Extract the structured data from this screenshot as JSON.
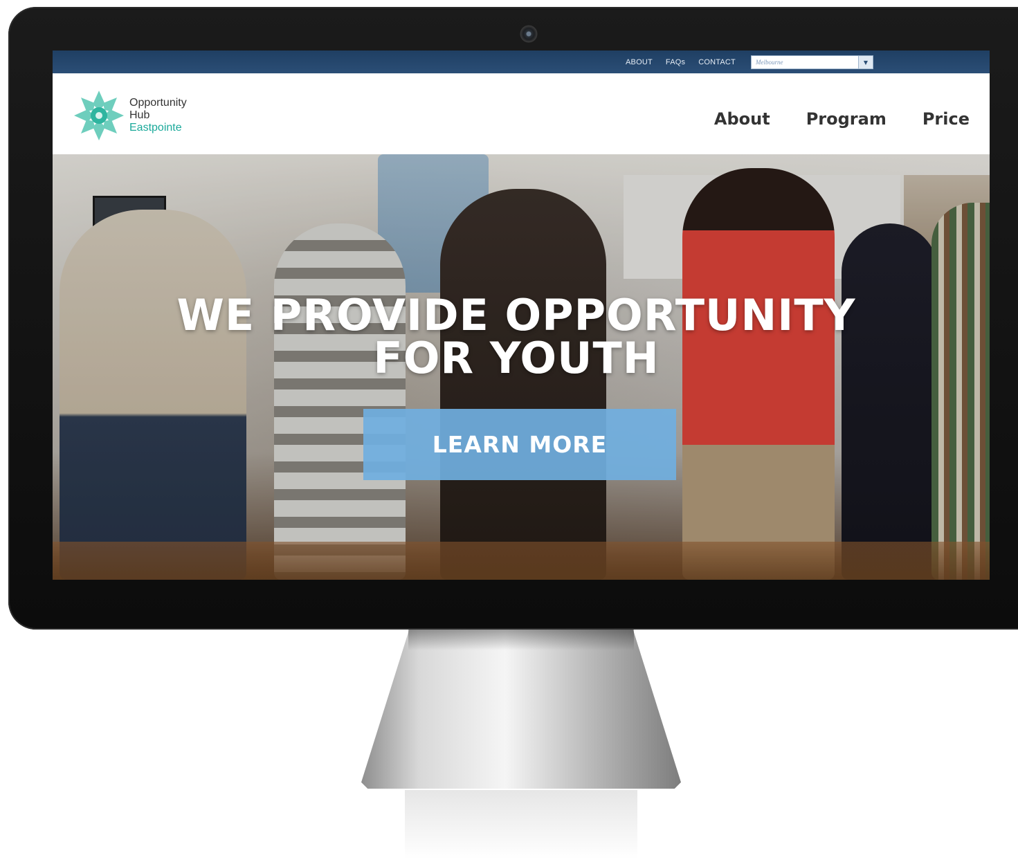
{
  "topbar": {
    "links": [
      "ABOUT",
      "FAQs",
      "CONTACT"
    ],
    "language_select_value": "Melbourne"
  },
  "logo": {
    "line1": "Opportunity",
    "line2": "Hub",
    "line3": "Eastpointe",
    "icon": "star-flower-icon",
    "color": "#1aa99a"
  },
  "nav": {
    "items": [
      "About",
      "Program",
      "Price"
    ]
  },
  "hero": {
    "headline_line1": "WE PROVIDE OPPORTUNITY",
    "headline_line2": "FOR YOUTH",
    "cta_label": "LEARN MORE",
    "cta_color": "#70afe0"
  },
  "colors": {
    "topbar": "#1f3f63",
    "accent": "#1aa99a"
  }
}
